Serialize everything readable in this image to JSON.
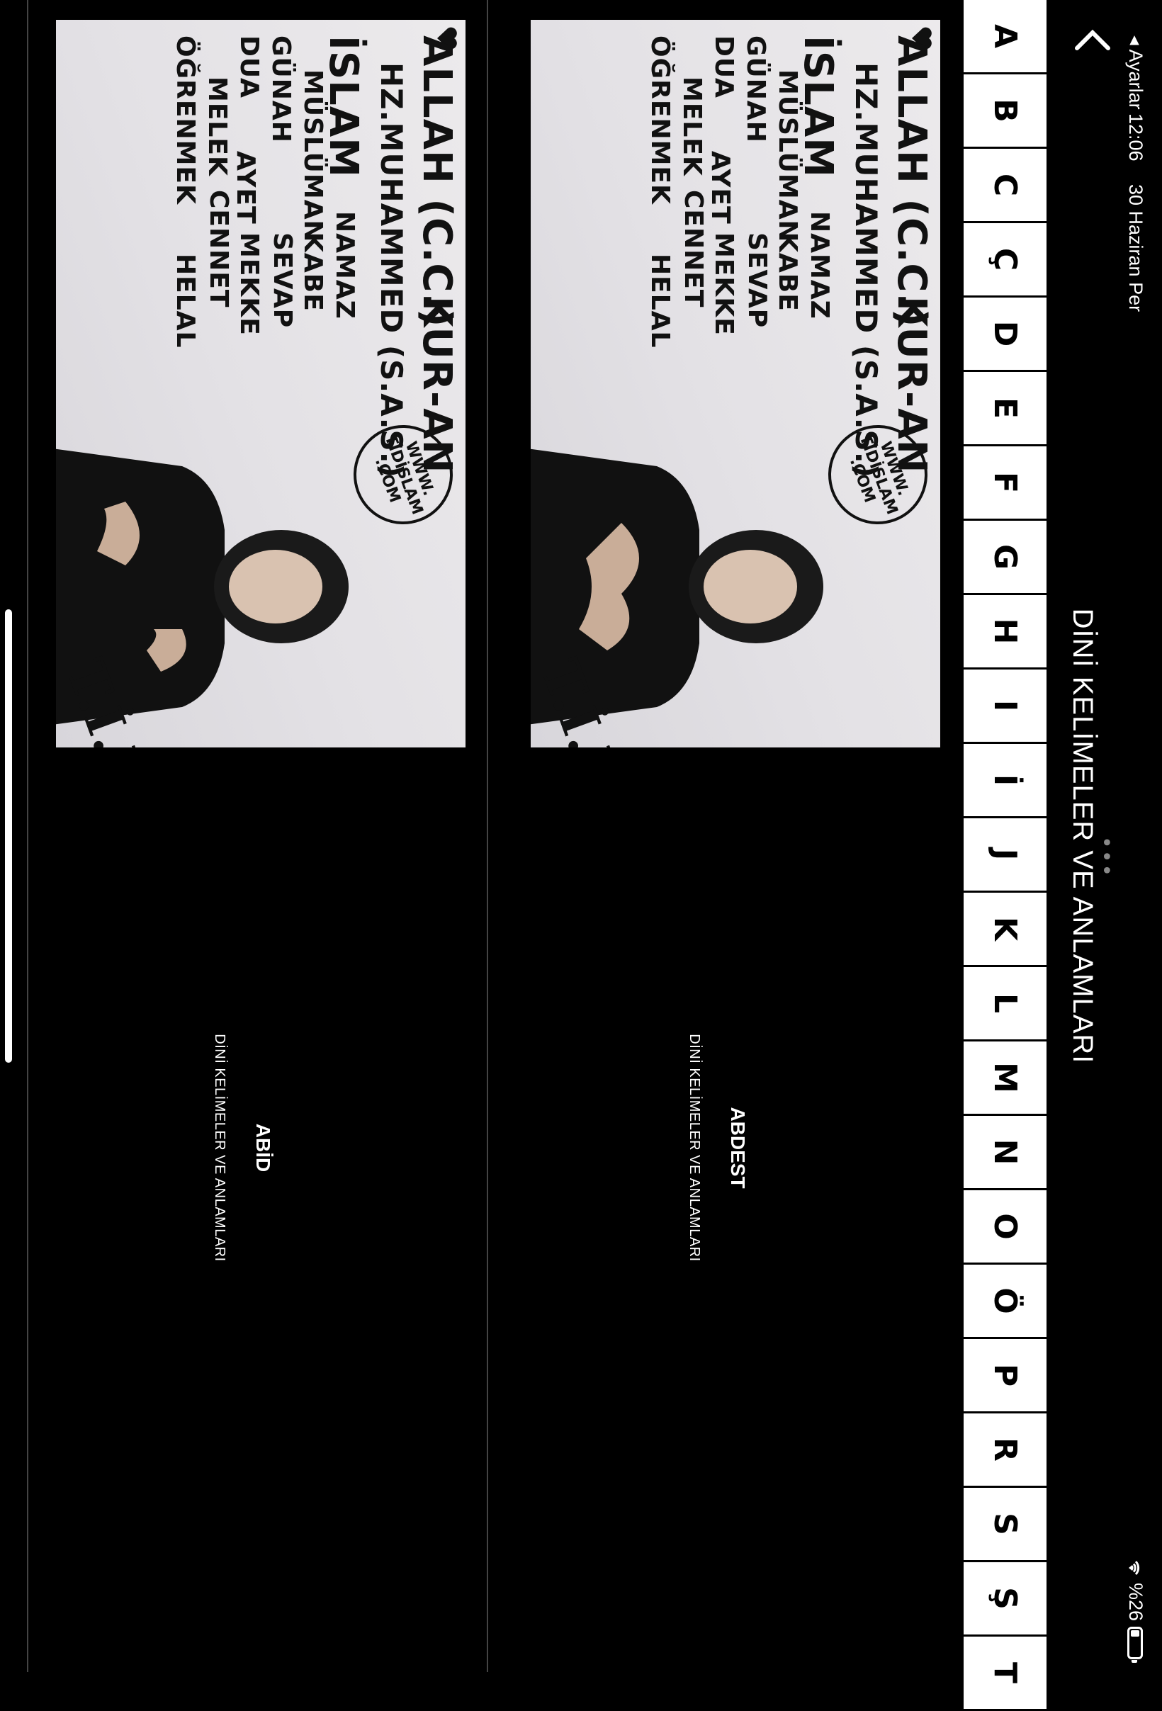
{
  "status_bar": {
    "back_app": "◂ Ayarlar",
    "time": "12:06",
    "date": "30 Haziran Per",
    "battery_text": "%26",
    "battery_level": 0.26
  },
  "nav": {
    "title": "DİNİ KELİMELER VE ANLAMLARI",
    "more_dots": "•••"
  },
  "alphabet": [
    "A",
    "B",
    "C",
    "Ç",
    "D",
    "E",
    "F",
    "G",
    "H",
    "I",
    "İ",
    "J",
    "K",
    "L",
    "M",
    "N",
    "O",
    "Ö",
    "P",
    "R",
    "S",
    "Ş",
    "T"
  ],
  "thumbnail": {
    "words": {
      "allah": "ALLAH (C.C.)",
      "kuran": "KUR-AN",
      "muhammed": "HZ.MUHAMMED (S.A.S.)",
      "islam": "İSLAM",
      "namaz": "NAMAZ",
      "musluman": "MÜSLÜMAN",
      "kabe": "KABE",
      "gunah": "GÜNAH",
      "sevap": "SEVAP",
      "dua": "DUA",
      "ayet": "AYET",
      "mekke": "MEKKE",
      "melek": "MELEK",
      "cennet": "CENNET",
      "ogrenmek": "ÖĞRENMEK",
      "helal": "HELAL"
    },
    "logo_lines": [
      "WWW.",
      "TİDİSLAM",
      ".COM"
    ],
    "tid": "T.İ.D."
  },
  "items": [
    {
      "title": "ABDEST",
      "subtitle": "DİNİ KELİMELER VE ANLAMLARI"
    },
    {
      "title": "ABİD",
      "subtitle": "DİNİ KELİMELER VE ANLAMLARI"
    }
  ]
}
